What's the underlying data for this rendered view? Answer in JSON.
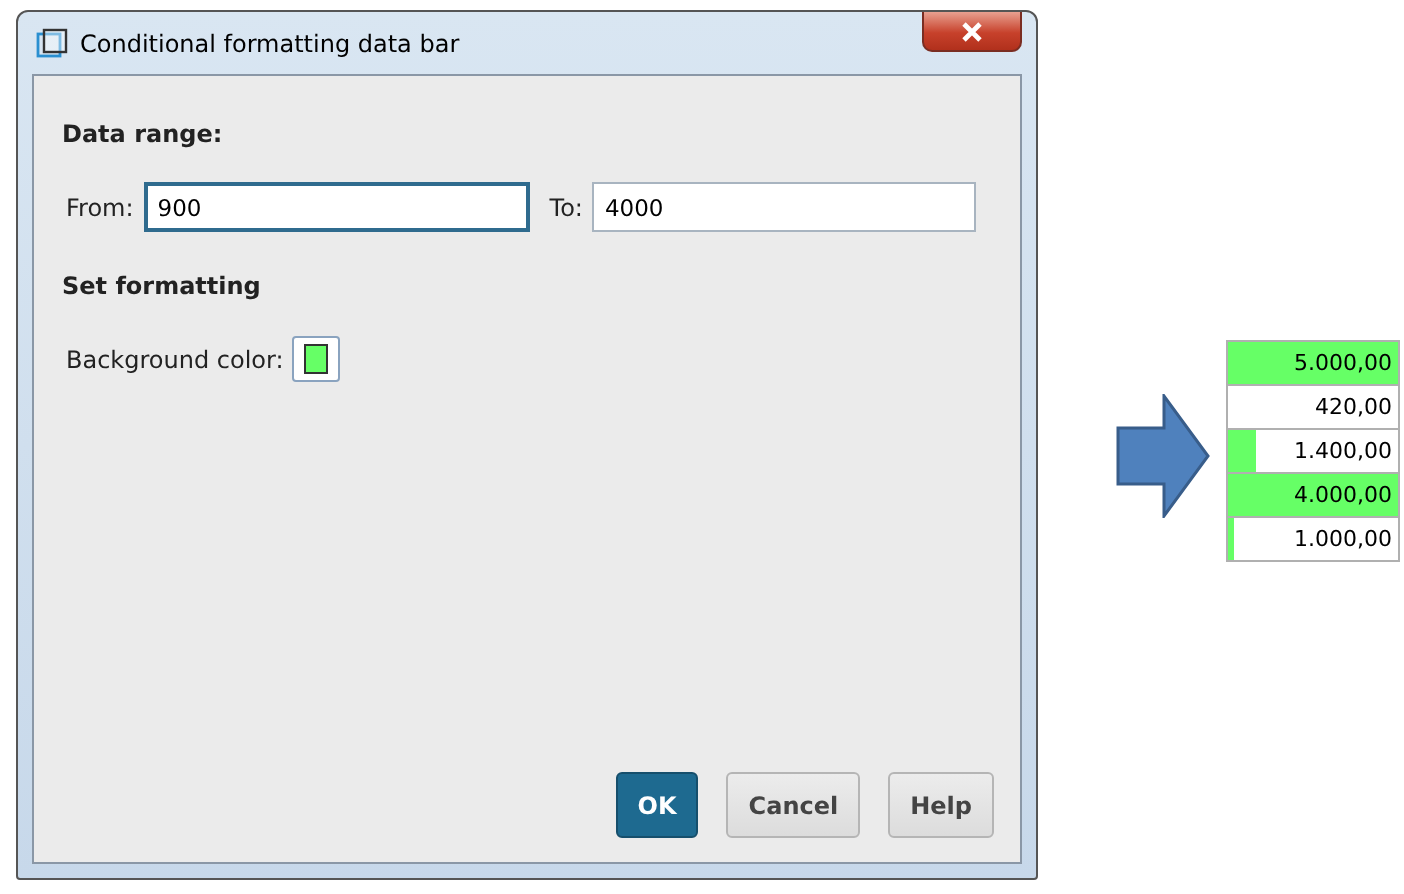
{
  "window": {
    "title": "Conditional formatting data bar"
  },
  "data_range": {
    "heading": "Data range:",
    "from_label": "From:",
    "from_value": "900",
    "to_label": "To:",
    "to_value": "4000"
  },
  "formatting": {
    "heading": "Set formatting",
    "background_label": "Background color:",
    "color": "#66ff66"
  },
  "buttons": [
    {
      "label": "OK",
      "default": true
    },
    {
      "label": "Cancel",
      "default": false
    },
    {
      "label": "Help",
      "default": false
    }
  ],
  "cells": [
    {
      "value": "5.000,00",
      "level": 1
    },
    {
      "value": "420,00"
    },
    {
      "value": "1.400,00",
      "level": 0.16
    },
    {
      "value": "4.000,00",
      "level": 1
    },
    {
      "value": "1.000,00",
      "level": 0.03
    }
  ]
}
